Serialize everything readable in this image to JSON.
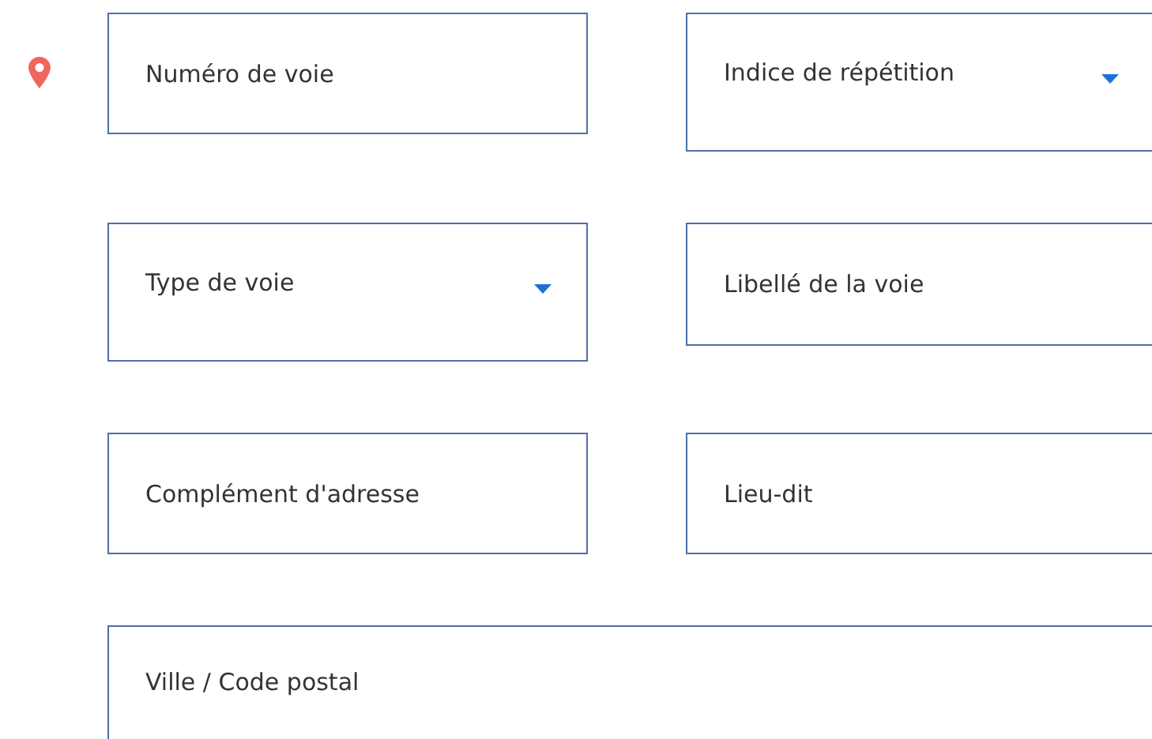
{
  "rows": [
    [
      {
        "kind": "text",
        "placeholder": "Numéro de voie"
      },
      {
        "kind": "select",
        "placeholder": "Indice de répétition"
      }
    ],
    [
      {
        "kind": "select",
        "placeholder": "Type de voie"
      },
      {
        "kind": "text",
        "placeholder": "Libellé de la voie"
      }
    ],
    [
      {
        "kind": "text",
        "placeholder": "Complément d'adresse"
      },
      {
        "kind": "text",
        "placeholder": "Lieu-dit"
      }
    ],
    [
      {
        "kind": "text",
        "placeholder": "Ville / Code postal"
      }
    ]
  ]
}
